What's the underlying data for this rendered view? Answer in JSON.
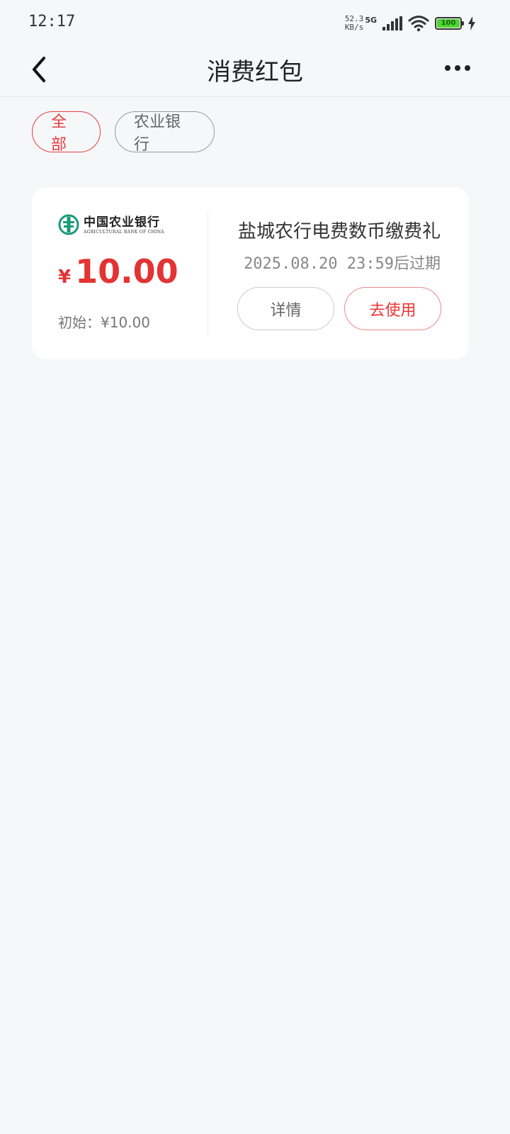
{
  "status_bar": {
    "time": "12:17",
    "net_speed_value": "52.3",
    "net_speed_unit": "KB/s",
    "network_type": "5G",
    "battery": "100"
  },
  "nav": {
    "title": "消费红包"
  },
  "filters": [
    {
      "label": "全部",
      "active": true
    },
    {
      "label": "农业银行",
      "active": false
    }
  ],
  "coupon": {
    "bank_name_cn": "中国农业银行",
    "bank_name_en": "AGRICULTURAL BANK OF CHINA",
    "currency_symbol": "¥",
    "amount": "10.00",
    "initial_label": "初始：¥10.00",
    "name": "盐城农行电费数币缴费礼",
    "expire_text": "2025.08.20 23:59后过期",
    "detail_button": "详情",
    "use_button": "去使用"
  },
  "colors": {
    "accent": "#e53e3e",
    "background": "#f6f7f9",
    "bank_green": "#1a9a78"
  }
}
